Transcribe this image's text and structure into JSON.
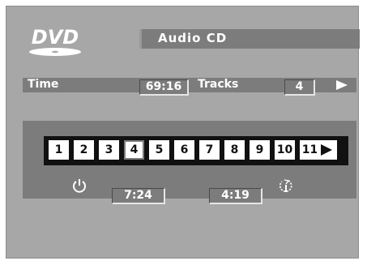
{
  "logo": {
    "text": "DVD"
  },
  "header": {
    "title": "Audio CD"
  },
  "info": {
    "time_label": "Time",
    "time_value": "69:16",
    "tracks_label": "Tracks",
    "tracks_value": "4"
  },
  "tracks": [
    "1",
    "2",
    "3",
    "4",
    "5",
    "6",
    "7",
    "8",
    "9",
    "10",
    "11"
  ],
  "selected_track": "4",
  "panel": {
    "elapsed": "7:24",
    "remaining": "4:19"
  },
  "icons": {
    "power": "power-icon",
    "repeat": "repeat-icon",
    "next": "play-next-icon"
  }
}
